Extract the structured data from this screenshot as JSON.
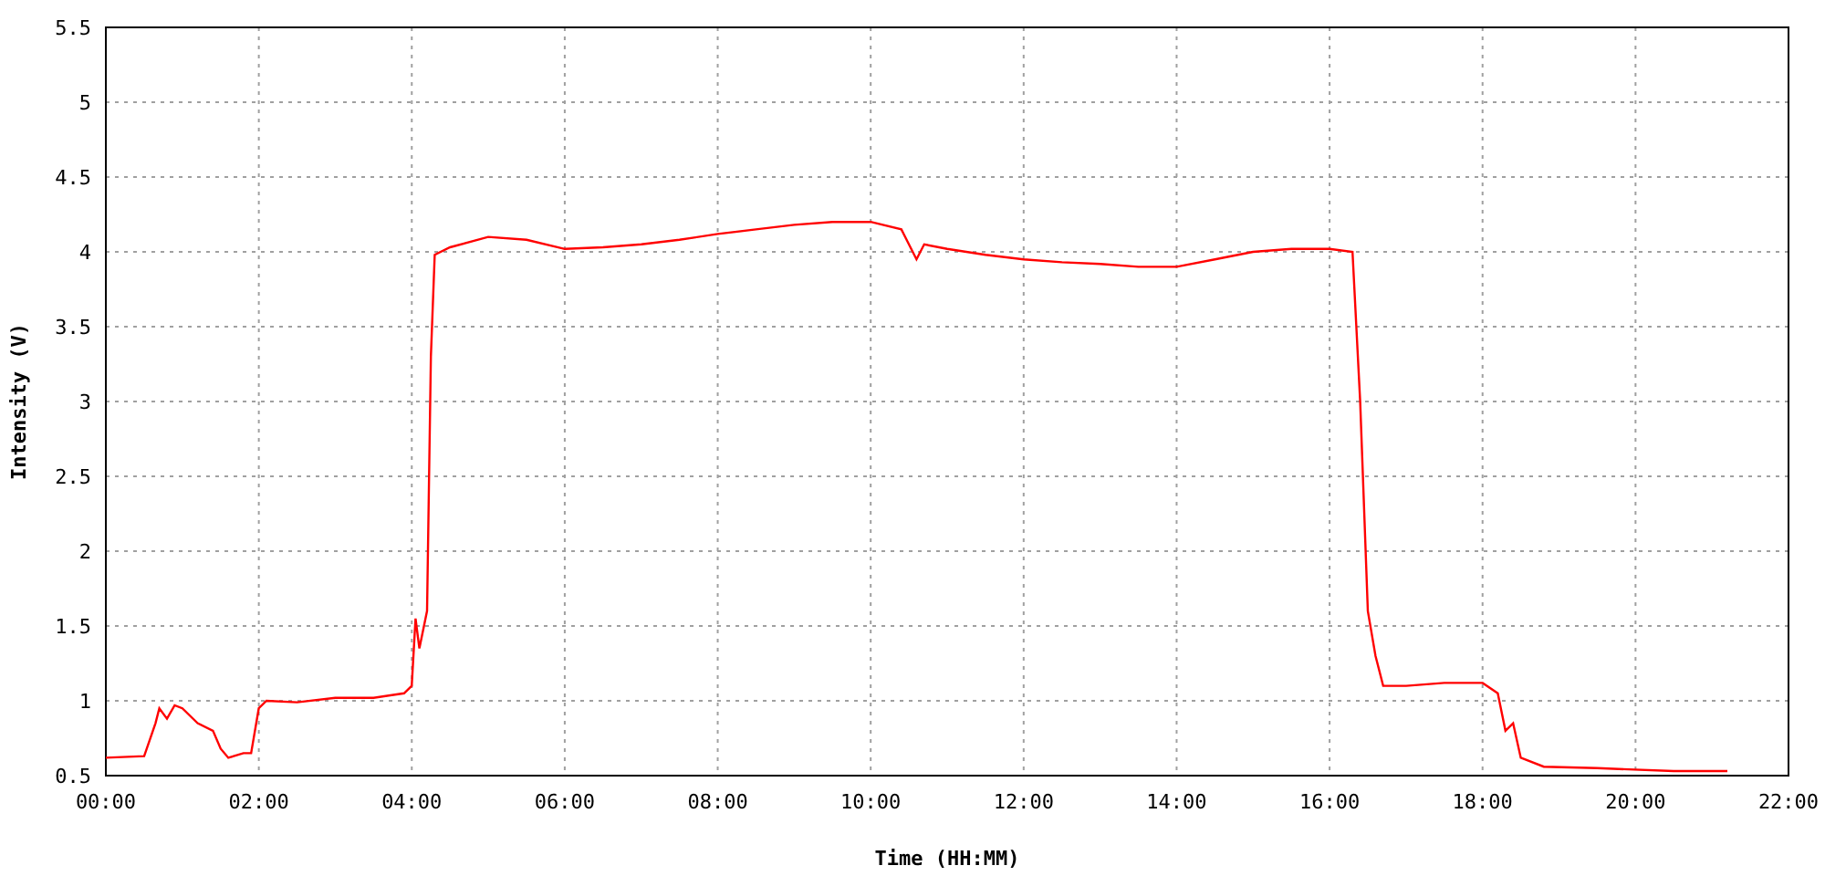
{
  "chart": {
    "chart_data": {
      "type": "line",
      "xlabel": "Time (HH:MM)",
      "ylabel": "Intensity (V)",
      "grid": true,
      "xlim": [
        0,
        22
      ],
      "ylim": [
        0.5,
        5.5
      ],
      "xticks": [
        {
          "value": 0,
          "label": "00:00"
        },
        {
          "value": 2,
          "label": "02:00"
        },
        {
          "value": 4,
          "label": "04:00"
        },
        {
          "value": 6,
          "label": "06:00"
        },
        {
          "value": 8,
          "label": "08:00"
        },
        {
          "value": 10,
          "label": "10:00"
        },
        {
          "value": 12,
          "label": "12:00"
        },
        {
          "value": 14,
          "label": "14:00"
        },
        {
          "value": 16,
          "label": "16:00"
        },
        {
          "value": 18,
          "label": "18:00"
        },
        {
          "value": 20,
          "label": "20:00"
        },
        {
          "value": 22,
          "label": "22:00"
        }
      ],
      "yticks": [
        0.5,
        1,
        1.5,
        2,
        2.5,
        3,
        3.5,
        4,
        4.5,
        5,
        5.5
      ],
      "x": [
        0,
        0.5,
        0.65,
        0.7,
        0.8,
        0.9,
        1.0,
        1.2,
        1.4,
        1.5,
        1.6,
        1.8,
        1.9,
        2.0,
        2.1,
        2.5,
        3.0,
        3.5,
        3.9,
        4.0,
        4.05,
        4.1,
        4.2,
        4.25,
        4.3,
        4.5,
        5.0,
        5.5,
        6.0,
        6.5,
        7.0,
        7.5,
        8.0,
        8.5,
        9.0,
        9.5,
        10.0,
        10.4,
        10.6,
        10.7,
        11.0,
        11.5,
        12.0,
        12.5,
        13.0,
        13.5,
        14.0,
        14.5,
        15.0,
        15.5,
        16.0,
        16.3,
        16.4,
        16.5,
        16.6,
        16.7,
        17.0,
        17.5,
        18.0,
        18.2,
        18.3,
        18.4,
        18.5,
        18.8,
        19.5,
        20.5,
        21.2
      ],
      "series": [
        {
          "color": "#ff0000",
          "values": [
            0.62,
            0.63,
            0.85,
            0.95,
            0.88,
            0.97,
            0.95,
            0.85,
            0.8,
            0.68,
            0.62,
            0.65,
            0.65,
            0.95,
            1.0,
            0.99,
            1.02,
            1.02,
            1.05,
            1.1,
            1.55,
            1.35,
            1.6,
            3.3,
            3.98,
            4.03,
            4.1,
            4.08,
            4.02,
            4.03,
            4.05,
            4.08,
            4.12,
            4.15,
            4.18,
            4.2,
            4.2,
            4.15,
            3.95,
            4.05,
            4.02,
            3.98,
            3.95,
            3.93,
            3.92,
            3.9,
            3.9,
            3.95,
            4.0,
            4.02,
            4.02,
            4.0,
            3.0,
            1.6,
            1.3,
            1.1,
            1.1,
            1.12,
            1.12,
            1.05,
            0.8,
            0.85,
            0.62,
            0.56,
            0.55,
            0.53,
            0.53
          ]
        }
      ]
    }
  }
}
